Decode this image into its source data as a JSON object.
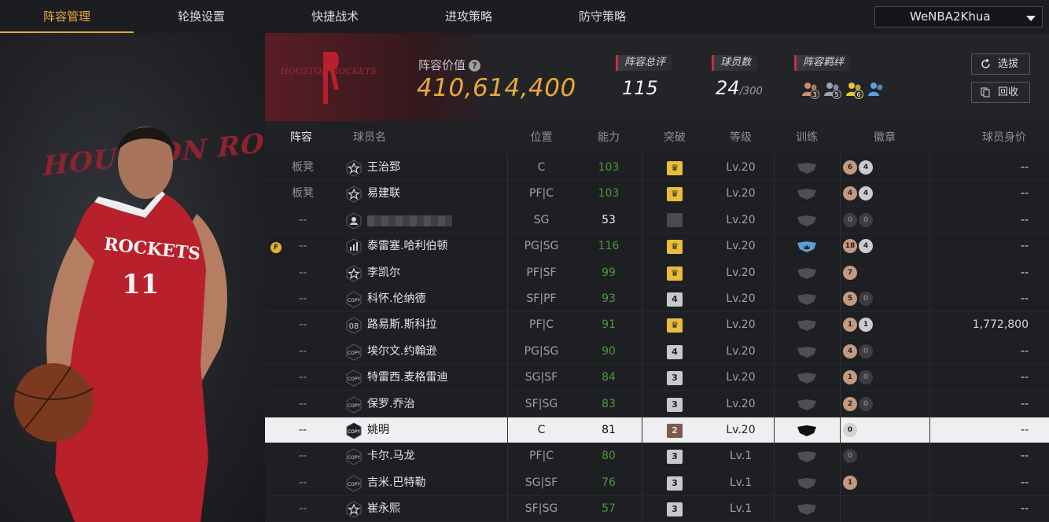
{
  "nav": {
    "tabs": [
      "阵容管理",
      "轮换设置",
      "快捷战术",
      "进攻策略",
      "防守策略"
    ],
    "active_tab": "阵容管理",
    "account": "WeNBA2Khua"
  },
  "portrait": {
    "bg_text": "HOUSTON ROCK",
    "jersey_text": "ROCKETS",
    "jersey_number": "11"
  },
  "header": {
    "team_logo_text": "HOUSTON ROCKETS",
    "value_label": "阵容价值",
    "value": "410,614,400",
    "overall_label": "阵容总评",
    "overall": "115",
    "players_label": "球员数",
    "players_count": "24",
    "players_max": "/300",
    "bonds_label": "阵容羁绊",
    "bonds": [
      {
        "icon": "player-pair-icon",
        "count": "3",
        "color": "#c98f6b"
      },
      {
        "icon": "player-group-icon",
        "count": "5",
        "color": "#9aa3b3"
      },
      {
        "icon": "player-group-icon",
        "count": "6",
        "color": "#e6c53a"
      },
      {
        "icon": "player-group-icon",
        "count": "",
        "color": "#5aa0e0"
      }
    ],
    "buttons": {
      "select": "选拔",
      "recycle": "回收"
    }
  },
  "colors": {
    "accent": "#e8a93a",
    "ability_green": "#4b9b3a",
    "team_red": "#a02a36"
  },
  "table": {
    "columns": [
      "阵容",
      "球员名",
      "位置",
      "能力",
      "突破",
      "等级",
      "训练",
      "徽章",
      "球员身价"
    ],
    "rows": [
      {
        "lineup": "板凳",
        "icon": "star-icon",
        "name": "王治郅",
        "pos": "C",
        "ability": "103",
        "break": {
          "type": "gold",
          "text": "♛"
        },
        "level": "Lv.20",
        "train": "dark",
        "badges": [
          {
            "k": "b",
            "v": "6"
          },
          {
            "k": "s",
            "v": "4"
          }
        ],
        "price": "--"
      },
      {
        "lineup": "板凳",
        "icon": "star-icon",
        "name": "易建联",
        "pos": "PF|C",
        "ability": "103",
        "break": {
          "type": "gold",
          "text": "♛"
        },
        "level": "Lv.20",
        "train": "dark",
        "badges": [
          {
            "k": "b",
            "v": "4"
          },
          {
            "k": "s",
            "v": "4"
          }
        ],
        "price": "--"
      },
      {
        "lineup": "--",
        "icon": "user-icon",
        "name": "",
        "blurred": true,
        "pos": "SG",
        "ability": "53",
        "ability_white": true,
        "break": {
          "type": "dark",
          "text": ""
        },
        "level": "Lv.20",
        "train": "dark",
        "badges": [
          {
            "k": "z",
            "v": "0"
          },
          {
            "k": "z",
            "v": "0"
          }
        ],
        "price": "--"
      },
      {
        "lineup": "--",
        "icon": "stats-icon",
        "name": "泰雷塞.哈利伯顿",
        "pos": "PG|SG",
        "ability": "116",
        "break": {
          "type": "gold",
          "text": "♛"
        },
        "level": "Lv.20",
        "train": "blue",
        "badges": [
          {
            "k": "b",
            "v": "18"
          },
          {
            "k": "s",
            "v": "4"
          }
        ],
        "price": "--",
        "flag": "F"
      },
      {
        "lineup": "--",
        "icon": "star-icon",
        "name": "李凯尔",
        "pos": "PF|SF",
        "ability": "99",
        "break": {
          "type": "gold",
          "text": "♛"
        },
        "level": "Lv.20",
        "train": "dark",
        "badges": [
          {
            "k": "b",
            "v": "7"
          }
        ],
        "price": "--"
      },
      {
        "lineup": "--",
        "icon": "copy-icon",
        "name": "科怀.伦纳德",
        "pos": "SF|PF",
        "ability": "93",
        "break": {
          "type": "gray",
          "text": "4"
        },
        "level": "Lv.20",
        "train": "dark",
        "badges": [
          {
            "k": "b",
            "v": "5"
          },
          {
            "k": "z",
            "v": "0"
          }
        ],
        "price": "--"
      },
      {
        "lineup": "--",
        "icon": "number-icon",
        "name": "路易斯.斯科拉",
        "pos": "PF|C",
        "ability": "91",
        "break": {
          "type": "gold",
          "text": "♛"
        },
        "level": "Lv.20",
        "train": "dark",
        "badges": [
          {
            "k": "b",
            "v": "1"
          },
          {
            "k": "s",
            "v": "1"
          }
        ],
        "price": "1,772,800"
      },
      {
        "lineup": "--",
        "icon": "copy-icon",
        "name": "埃尔文.约翰逊",
        "pos": "PG|SG",
        "ability": "90",
        "break": {
          "type": "gray",
          "text": "4"
        },
        "level": "Lv.20",
        "train": "dark",
        "badges": [
          {
            "k": "b",
            "v": "4"
          },
          {
            "k": "z",
            "v": "0"
          }
        ],
        "price": "--"
      },
      {
        "lineup": "--",
        "icon": "copy-icon",
        "name": "特雷西.麦格雷迪",
        "pos": "SG|SF",
        "ability": "84",
        "break": {
          "type": "gray",
          "text": "3"
        },
        "level": "Lv.20",
        "train": "dark",
        "badges": [
          {
            "k": "b",
            "v": "1"
          },
          {
            "k": "z",
            "v": "0"
          }
        ],
        "price": "--"
      },
      {
        "lineup": "--",
        "icon": "copy-icon",
        "name": "保罗.乔治",
        "pos": "SF|SG",
        "ability": "83",
        "break": {
          "type": "gray",
          "text": "3"
        },
        "level": "Lv.20",
        "train": "dark",
        "badges": [
          {
            "k": "b",
            "v": "2"
          },
          {
            "k": "z",
            "v": "0"
          }
        ],
        "price": "--"
      },
      {
        "lineup": "--",
        "icon": "copy-icon",
        "name": "姚明",
        "pos": "C",
        "ability": "81",
        "break": {
          "type": "bronze",
          "text": "2"
        },
        "level": "Lv.20",
        "train": "black",
        "badges": [
          {
            "k": "w",
            "v": "0"
          }
        ],
        "price": "--",
        "selected": true
      },
      {
        "lineup": "--",
        "icon": "copy-icon",
        "name": "卡尔.马龙",
        "pos": "PF|C",
        "ability": "80",
        "break": {
          "type": "gray",
          "text": "3"
        },
        "level": "Lv.1",
        "train": "dark",
        "badges": [
          {
            "k": "z",
            "v": "0"
          }
        ],
        "price": "--"
      },
      {
        "lineup": "--",
        "icon": "copy-icon",
        "name": "吉米.巴特勒",
        "pos": "SG|SF",
        "ability": "76",
        "break": {
          "type": "gray",
          "text": "3"
        },
        "level": "Lv.1",
        "train": "dark",
        "badges": [
          {
            "k": "b",
            "v": "1"
          }
        ],
        "price": "--"
      },
      {
        "lineup": "--",
        "icon": "star-icon",
        "name": "崔永熙",
        "pos": "SF|SG",
        "ability": "57",
        "break": {
          "type": "gray",
          "text": "3"
        },
        "level": "Lv.1",
        "train": "dark",
        "badges": [],
        "price": "--"
      }
    ]
  }
}
